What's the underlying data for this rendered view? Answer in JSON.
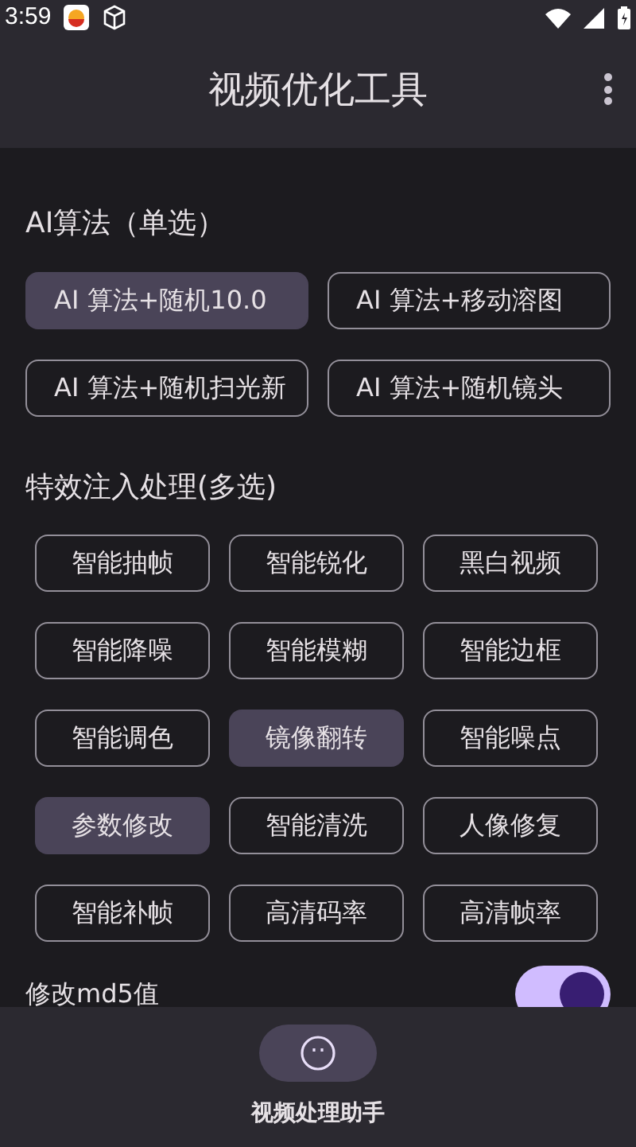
{
  "status_bar": {
    "time": "3:59"
  },
  "app_bar": {
    "title": "视频优化工具"
  },
  "ai_section": {
    "title": "AI算法（单选）",
    "options": [
      {
        "label": "AI 算法+随机10.0",
        "selected": true
      },
      {
        "label": "AI 算法+移动溶图",
        "selected": false
      },
      {
        "label": "AI 算法+随机扫光新",
        "selected": false
      },
      {
        "label": "AI 算法+随机镜头",
        "selected": false
      }
    ]
  },
  "effects_section": {
    "title": "特效注入处理(多选)",
    "options": [
      {
        "label": "智能抽帧",
        "selected": false
      },
      {
        "label": "智能锐化",
        "selected": false
      },
      {
        "label": "黑白视频",
        "selected": false
      },
      {
        "label": "智能降噪",
        "selected": false
      },
      {
        "label": "智能模糊",
        "selected": false
      },
      {
        "label": "智能边框",
        "selected": false
      },
      {
        "label": "智能调色",
        "selected": false
      },
      {
        "label": "镜像翻转",
        "selected": true
      },
      {
        "label": "智能噪点",
        "selected": false
      },
      {
        "label": "参数修改",
        "selected": true
      },
      {
        "label": "智能清洗",
        "selected": false
      },
      {
        "label": "人像修复",
        "selected": false
      },
      {
        "label": "智能补帧",
        "selected": false
      },
      {
        "label": "高清码率",
        "selected": false
      },
      {
        "label": "高清帧率",
        "selected": false
      }
    ]
  },
  "md5_setting": {
    "label": "修改md5值",
    "on": true
  },
  "bottom_nav": {
    "items": [
      {
        "label": "视频处理助手",
        "selected": true
      }
    ]
  }
}
